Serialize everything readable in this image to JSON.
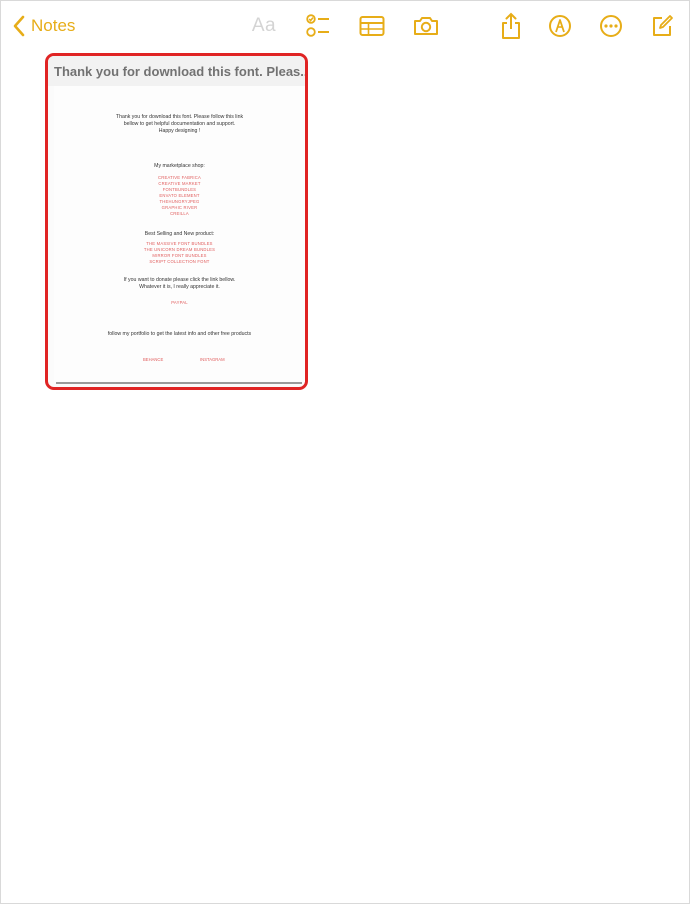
{
  "toolbar": {
    "back_label": "Notes",
    "format_label": "Aa",
    "icons": [
      "chevron-left-icon",
      "checklist-icon",
      "table-icon",
      "camera-icon",
      "share-icon",
      "markup-icon",
      "more-icon",
      "compose-icon"
    ],
    "accent_color": "#e7ad18",
    "disabled_color": "#d4d4d4"
  },
  "scan": {
    "title": "Thank you for download this font. Pleas...",
    "highlight_color": "#e02424",
    "document": {
      "intro": [
        "Thank you for download this font. Please follow this link",
        "bellow to get helpful documentation and support.",
        "Happy designing !"
      ],
      "marketplace_heading": "My marketplace shop:",
      "marketplace_links": [
        "CREATIVE FABRICA",
        "CREATIVE MARKET",
        "FONTBUNDLES",
        "ENVATO ELEMENT",
        "THEHUNGRYJPEG",
        "GRAPHIC RIVER",
        "CREILLA"
      ],
      "products_heading": "Best Selling and New product:",
      "product_links": [
        "THE MASSIVE FONT BUNDLES",
        "THE UNICORN DREAM BUNDLES",
        "MIRROR FONT BUNDLES",
        "SCRIPT COLLECTION FONT"
      ],
      "donate_text": [
        "If you want to donate please click the link bellow.",
        "Whatever it is, I really appreciate it."
      ],
      "donate_link": "PAYPAL",
      "portfolio_text": "follow my portfolio to get the latest info and other free products",
      "social_links": [
        "BEHANCE",
        "INSTAGRAM"
      ]
    }
  }
}
